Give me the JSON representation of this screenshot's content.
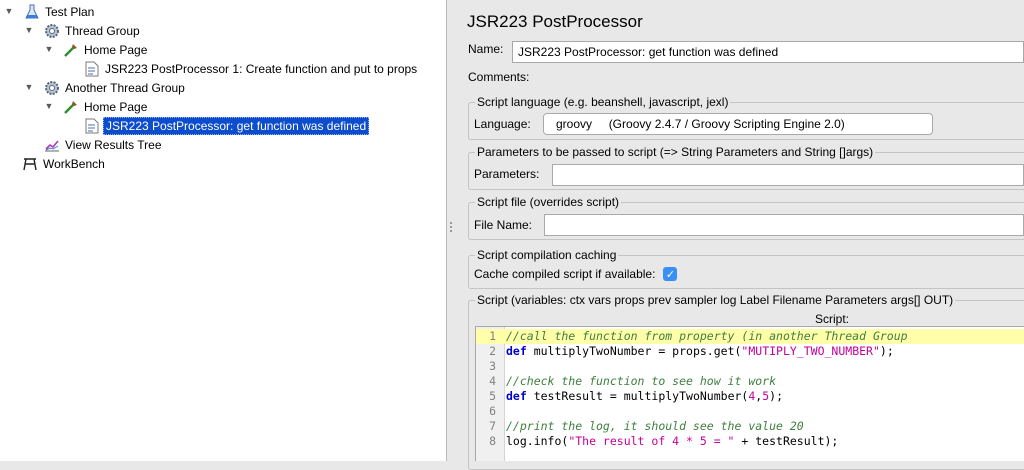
{
  "tree": {
    "items": [
      {
        "label": "Test Plan",
        "icon": "flask-icon"
      },
      {
        "label": "Thread Group",
        "icon": "gear-icon"
      },
      {
        "label": "Home Page",
        "icon": "sampler-icon"
      },
      {
        "label": "JSR223 PostProcessor 1: Create function and put to props",
        "icon": "script-icon"
      },
      {
        "label": "Another Thread Group",
        "icon": "gear-icon"
      },
      {
        "label": "Home Page",
        "icon": "sampler-icon"
      },
      {
        "label": "JSR223 PostProcessor: get function was defined",
        "icon": "script-icon",
        "selected": true
      },
      {
        "label": "View Results Tree",
        "icon": "chart-icon"
      },
      {
        "label": "WorkBench",
        "icon": "workbench-icon"
      }
    ]
  },
  "panel": {
    "title": "JSR223 PostProcessor",
    "name_label": "Name:",
    "name_value": "JSR223 PostProcessor: get function was defined",
    "comments_label": "Comments:",
    "language_group": "Script language (e.g. beanshell, javascript, jexl)",
    "language_label": "Language:",
    "language_value": "groovy     (Groovy 2.4.7 / Groovy Scripting Engine 2.0)",
    "params_group": "Parameters to be passed to script (=> String Parameters and String []args)",
    "params_label": "Parameters:",
    "params_value": "",
    "file_group": "Script file (overrides script)",
    "file_label": "File Name:",
    "file_value": "",
    "cache_group": "Script compilation caching",
    "cache_label": "Cache compiled script if available:",
    "cache_checked": true,
    "script_group": "Script (variables: ctx vars props prev sampler log Label Filename Parameters args[] OUT)",
    "script_header": "Script:"
  },
  "script": {
    "lines": [
      {
        "n": "1",
        "parts": [
          {
            "c": "cm",
            "t": "//call the function from property (in another Thread Group"
          }
        ]
      },
      {
        "n": "2",
        "parts": [
          {
            "c": "kw",
            "t": "def"
          },
          {
            "c": "",
            "t": " multiplyTwoNumber = props.get("
          },
          {
            "c": "st",
            "t": "\"MUTIPLY_TWO_NUMBER\""
          },
          {
            "c": "",
            "t": ");"
          }
        ]
      },
      {
        "n": "3",
        "parts": []
      },
      {
        "n": "4",
        "parts": [
          {
            "c": "cm",
            "t": "//check the function to see how it work"
          }
        ]
      },
      {
        "n": "5",
        "parts": [
          {
            "c": "kw",
            "t": "def"
          },
          {
            "c": "",
            "t": " testResult = multiplyTwoNumber("
          },
          {
            "c": "nm",
            "t": "4"
          },
          {
            "c": "",
            "t": ","
          },
          {
            "c": "nm",
            "t": "5"
          },
          {
            "c": "",
            "t": ");"
          }
        ]
      },
      {
        "n": "6",
        "parts": []
      },
      {
        "n": "7",
        "parts": [
          {
            "c": "cm",
            "t": "//print the log, it should see the value 20"
          }
        ]
      },
      {
        "n": "8",
        "parts": [
          {
            "c": "",
            "t": "log.info("
          },
          {
            "c": "st",
            "t": "\"The result of 4 * 5 = \""
          },
          {
            "c": "",
            "t": " + testResult);"
          }
        ]
      }
    ]
  },
  "colors": {
    "selection": "#0d4ccd",
    "highlight_line": "#ffffaa",
    "keyword": "#0000cc",
    "comment": "#3f7f3f",
    "string": "#c4009a",
    "checkbox": "#3a8ff5"
  }
}
